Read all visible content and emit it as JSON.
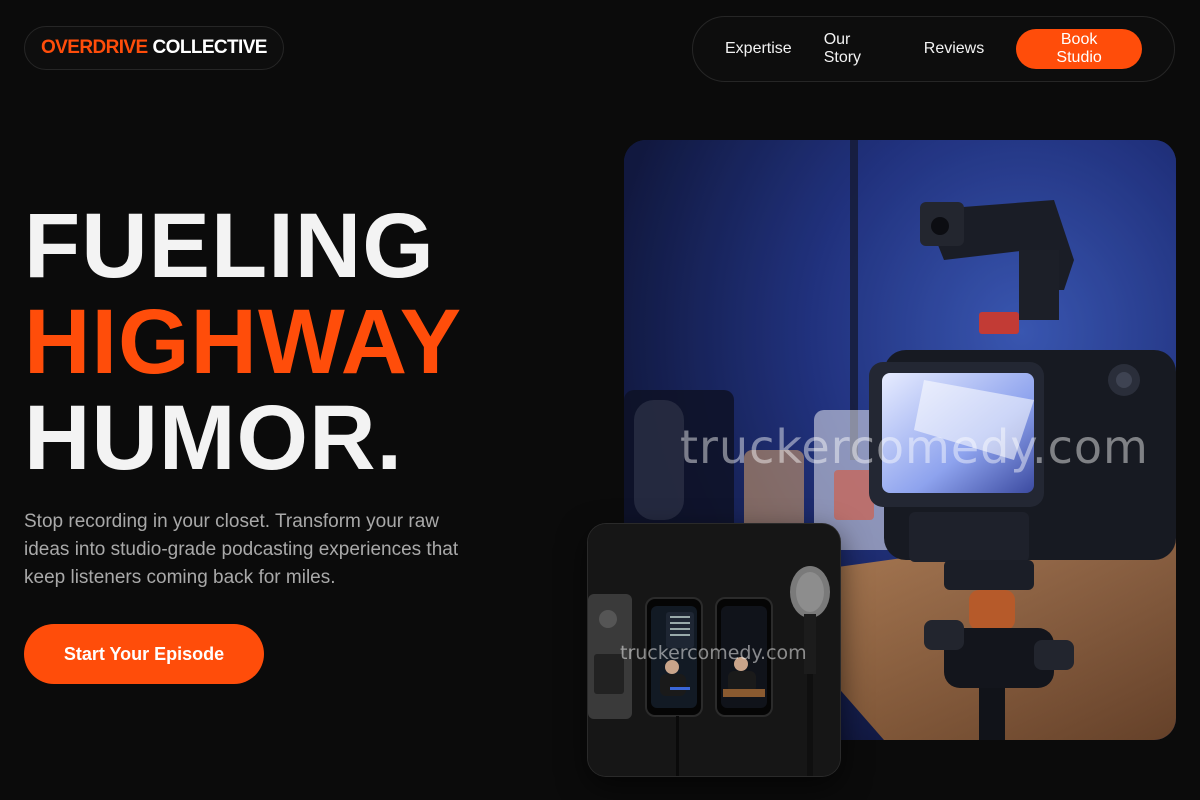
{
  "brand": {
    "accent_text": "OVERDRIVE",
    "rest_text": "COLLECTIVE",
    "accent_color": "#ff4d0a"
  },
  "nav": {
    "items": [
      {
        "label": "Expertise"
      },
      {
        "label": "Our Story"
      },
      {
        "label": "Reviews"
      }
    ],
    "cta_label": "Book Studio"
  },
  "hero": {
    "line1": "FUELING",
    "line2": "HIGHWAY",
    "line3": "HUMOR.",
    "subtitle": "Stop recording in your closet. Transform your raw ideas into studio-grade podcasting experiences that keep listeners coming back for miles.",
    "cta_label": "Start Your Episode"
  },
  "images": {
    "main_watermark": "truckercomedy.com",
    "side_watermark": "truckercomedy.com"
  }
}
